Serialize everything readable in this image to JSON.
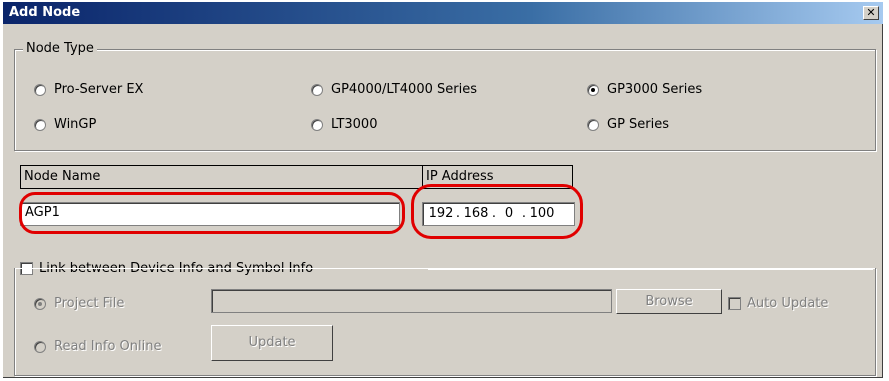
{
  "window": {
    "title": "Add Node",
    "close_glyph": "✕"
  },
  "node_type": {
    "legend": "Node Type",
    "options": [
      {
        "label": "Pro-Server EX",
        "checked": false
      },
      {
        "label": "GP4000/LT4000 Series",
        "checked": false
      },
      {
        "label": "GP3000 Series",
        "checked": true
      },
      {
        "label": "WinGP",
        "checked": false
      },
      {
        "label": "LT3000",
        "checked": false
      },
      {
        "label": "GP Series",
        "checked": false
      }
    ]
  },
  "table": {
    "node_name_header": "Node Name",
    "ip_address_header": "IP Address",
    "node_name_value": "AGP1",
    "ip_parts": [
      "192",
      "168",
      "0",
      "100"
    ]
  },
  "link": {
    "checkbox_label": "Link between Device Info and Symbol Info",
    "checked": false,
    "project_file_label": "Project File",
    "project_file_value": "",
    "browse_label": "Browse",
    "auto_update_label": "Auto Update",
    "read_info_online_label": "Read Info Online",
    "update_label": "Update"
  },
  "colors": {
    "highlight": "#e00000",
    "title_start": "#0a246a",
    "title_end": "#a6caf0"
  }
}
